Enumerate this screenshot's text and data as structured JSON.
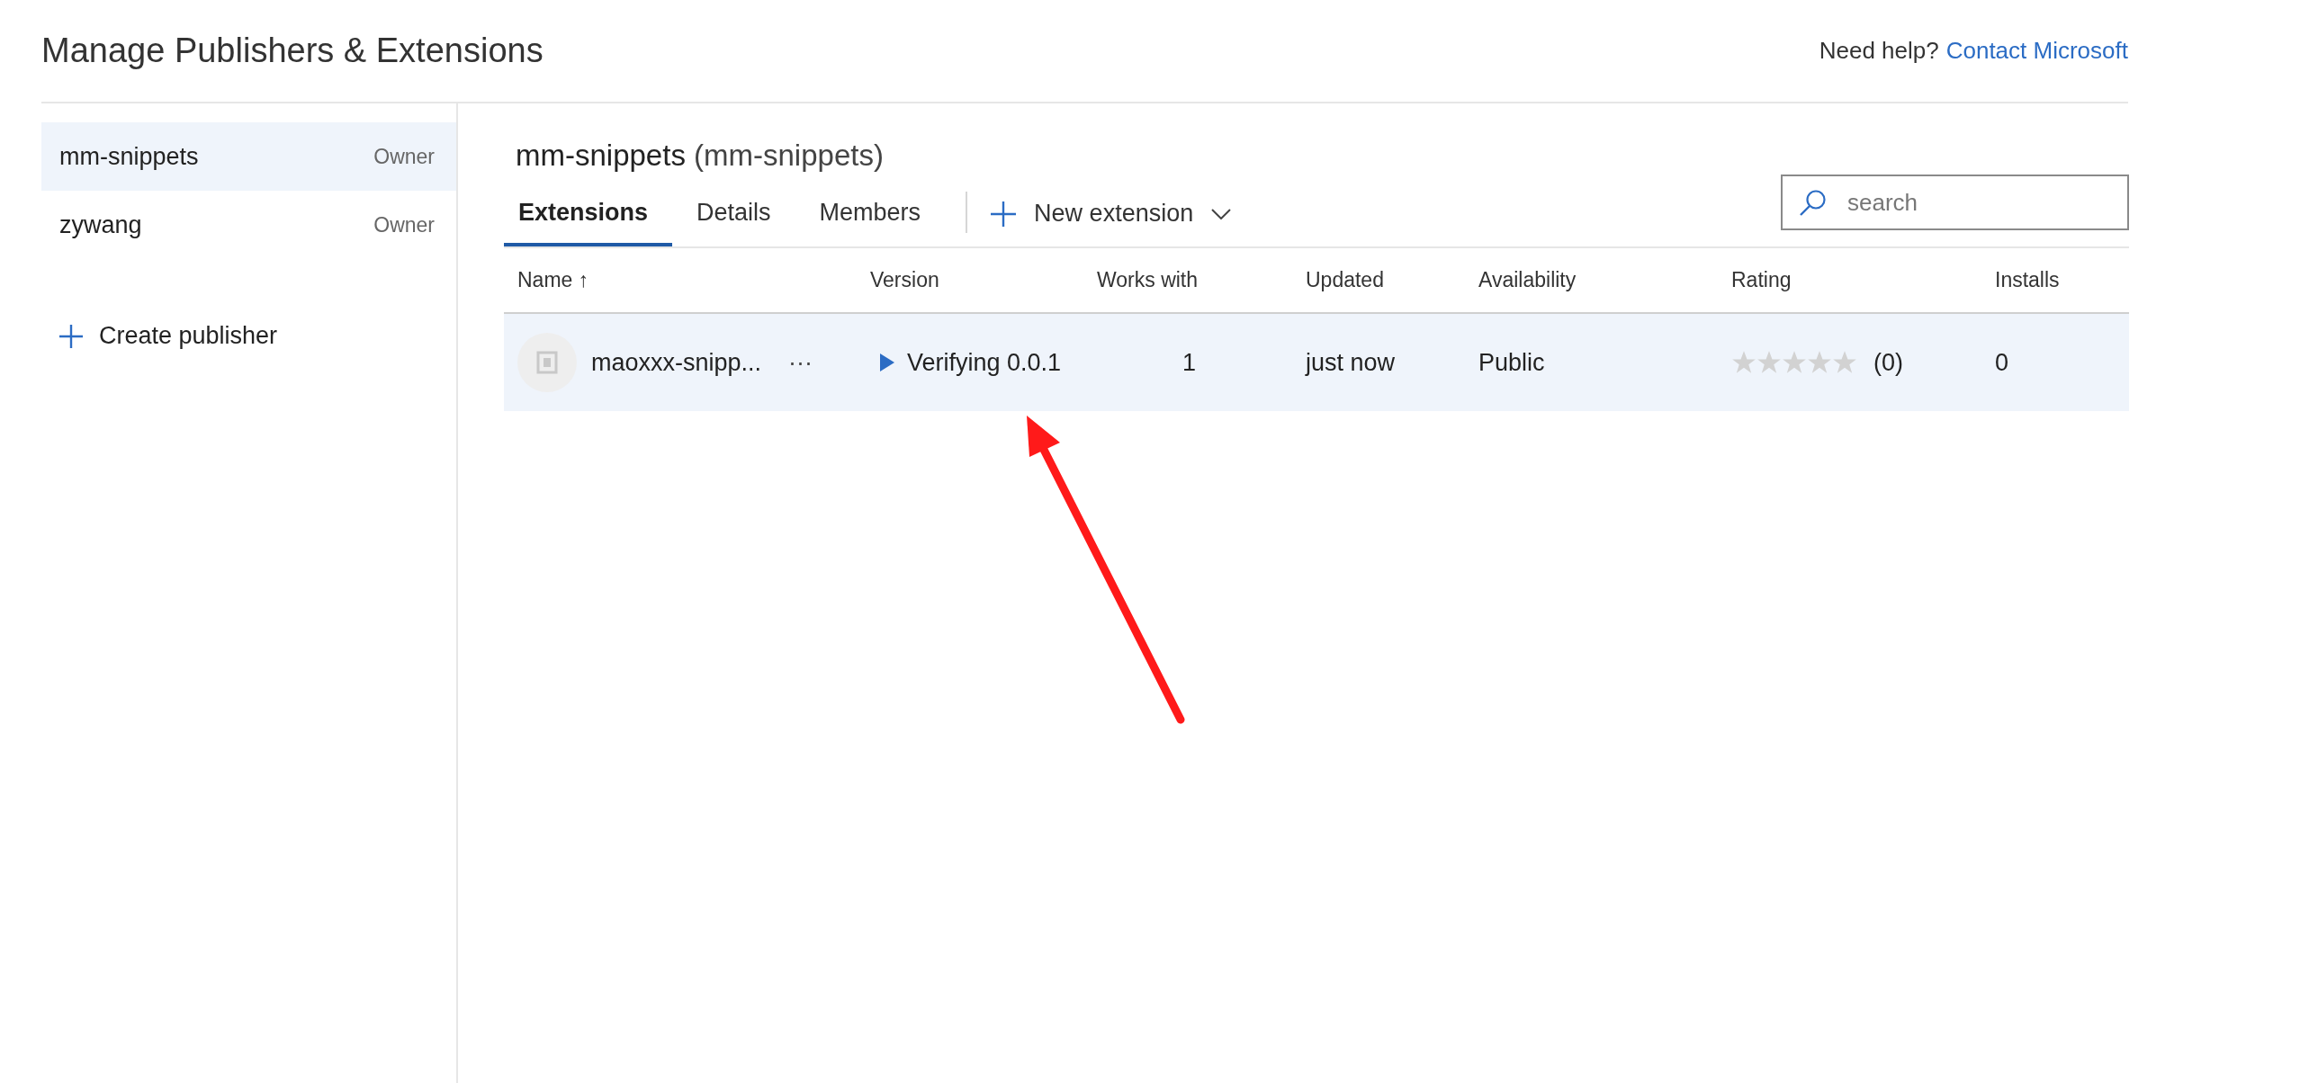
{
  "header": {
    "title": "Manage Publishers & Extensions",
    "help_text": "Need help?",
    "help_link": "Contact Microsoft"
  },
  "sidebar": {
    "publishers": [
      {
        "name": "mm-snippets",
        "role": "Owner",
        "selected": true
      },
      {
        "name": "zywang",
        "role": "Owner",
        "selected": false
      }
    ],
    "create_label": "Create publisher"
  },
  "main": {
    "title": "mm-snippets",
    "subtitle": "(mm-snippets)",
    "tabs": [
      {
        "label": "Extensions",
        "selected": true
      },
      {
        "label": "Details",
        "selected": false
      },
      {
        "label": "Members",
        "selected": false
      }
    ],
    "new_button": "New extension",
    "search": {
      "placeholder": "search"
    },
    "table": {
      "columns": [
        {
          "label": "Name",
          "sort": "↑"
        },
        {
          "label": "Version"
        },
        {
          "label": "Works with"
        },
        {
          "label": "Updated"
        },
        {
          "label": "Availability"
        },
        {
          "label": "Rating"
        },
        {
          "label": "Installs"
        }
      ],
      "rows": [
        {
          "name": "maoxxx-snipp...",
          "more": "···",
          "version": "Verifying 0.0.1",
          "works_with": "1",
          "updated": "just now",
          "availability": "Public",
          "stars": 0,
          "rating_count": "(0)",
          "installs": "0",
          "selected": true
        }
      ]
    }
  }
}
